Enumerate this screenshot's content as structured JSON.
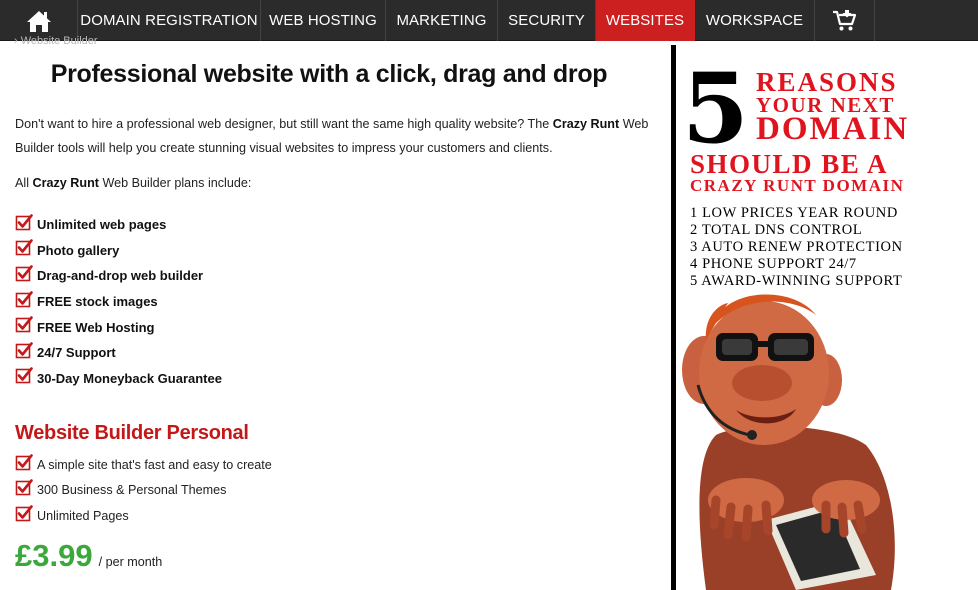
{
  "nav": {
    "items": [
      {
        "label": "DOMAIN REGISTRATION"
      },
      {
        "label": "WEB HOSTING"
      },
      {
        "label": "MARKETING"
      },
      {
        "label": "SECURITY"
      },
      {
        "label": "WEBSITES",
        "active": true
      },
      {
        "label": "WORKSPACE"
      }
    ],
    "icons": [
      "home-icon",
      "shopping-cart-icon"
    ],
    "active_color": "#cc1f1f",
    "bg_color": "#2b2b2b"
  },
  "breadcrumb": "› Website Builder",
  "main": {
    "title": "Professional website with a click, drag and drop",
    "intro_start": "Don't want to hire a professional web designer, but still want the same high quality website? The ",
    "brand": "Crazy Runt",
    "intro_end": " Web Builder tools will help you create stunning visual websites to impress your customers and clients.",
    "plans_intro_start": "All ",
    "plans_intro_end": " Web Builder plans include:",
    "features": [
      "Unlimited web pages",
      "Photo gallery",
      "Drag-and-drop web builder",
      "FREE stock images",
      "FREE Web Hosting",
      "24/7 Support",
      "30-Day Moneyback Guarantee"
    ]
  },
  "plan": {
    "title": "Website Builder Personal",
    "features": [
      "A simple site that's fast and easy to create",
      "300 Business & Personal Themes",
      "Unlimited Pages"
    ],
    "price": "£3.99",
    "per": "/ per month",
    "price_color": "#3aa83a",
    "title_color": "#c41818"
  },
  "banner": {
    "number": "5",
    "line1": "REASONS",
    "line2": "YOUR NEXT",
    "line3": "DOMAIN",
    "line4": "SHOULD BE A",
    "line5": "CRAZY RUNT DOMAIN",
    "reasons": [
      "1 LOW PRICES YEAR ROUND",
      "2 TOTAL DNS CONTROL",
      "3 AUTO RENEW PROTECTION",
      "4 PHONE SUPPORT 24/7",
      "5 AWARD-WINNING SUPPORT"
    ],
    "accent_color": "#e0141e"
  }
}
